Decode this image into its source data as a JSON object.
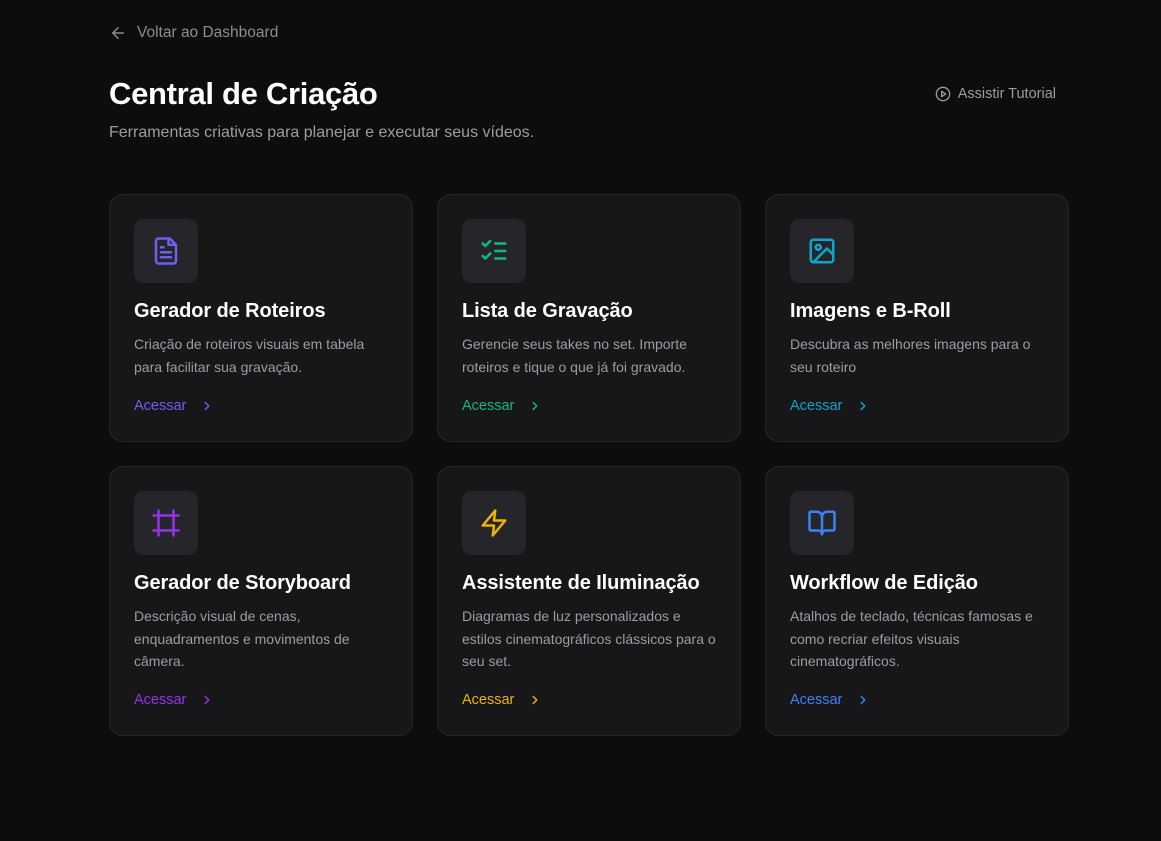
{
  "nav": {
    "back_label": "Voltar ao Dashboard"
  },
  "header": {
    "title": "Central de Criação",
    "subtitle": "Ferramentas criativas para planejar e executar seus vídeos.",
    "tutorial_label": "Assistir Tutorial"
  },
  "cards": [
    {
      "title": "Gerador de Roteiros",
      "description": "Criação de roteiros visuais em tabela para facilitar sua gravação.",
      "link_label": "Acessar",
      "icon": "file-text-icon",
      "accent": "#6d5ff0"
    },
    {
      "title": "Lista de Gravação",
      "description": "Gerencie seus takes no set. Importe roteiros e tique o que já foi gravado.",
      "link_label": "Acessar",
      "icon": "list-checks-icon",
      "accent": "#10b981"
    },
    {
      "title": "Imagens e B-Roll",
      "description": "Descubra as melhores imagens para o seu roteiro",
      "link_label": "Acessar",
      "icon": "image-icon",
      "accent": "#0ea5c9"
    },
    {
      "title": "Gerador de Storyboard",
      "description": "Descrição visual de cenas, enquadramentos e movimentos de câmera.",
      "link_label": "Acessar",
      "icon": "frame-icon",
      "accent": "#9333ea"
    },
    {
      "title": "Assistente de Iluminação",
      "description": "Diagramas de luz personalizados e estilos cinematográficos clássicos para o seu set.",
      "link_label": "Acessar",
      "icon": "zap-icon",
      "accent": "#eab308"
    },
    {
      "title": "Workflow de Edição",
      "description": "Atalhos de teclado, técnicas famosas e como recriar efeitos visuais cinematográficos.",
      "link_label": "Acessar",
      "icon": "book-open-icon",
      "accent": "#3b82f6"
    }
  ]
}
